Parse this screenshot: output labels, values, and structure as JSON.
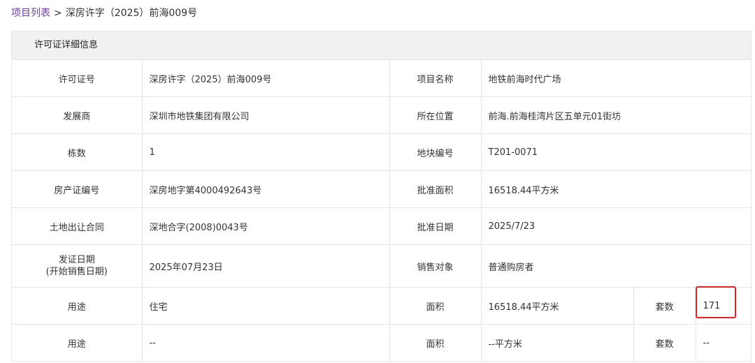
{
  "breadcrumb": {
    "root": "项目列表",
    "separator": ">",
    "current": "深房许字（2025）前海009号"
  },
  "panel": {
    "title": "许可证详细信息"
  },
  "rows": [
    {
      "l1": "许可证号",
      "v1": "深房许字（2025）前海009号",
      "l2": "项目名称",
      "v2": "地铁前海时代广场"
    },
    {
      "l1": "发展商",
      "v1": "深圳市地铁集团有限公司",
      "l2": "所在位置",
      "v2": "前海.前海桂湾片区五单元01街坊"
    },
    {
      "l1": "栋数",
      "v1": "1",
      "l2": "地块编号",
      "v2": "T201-0071"
    },
    {
      "l1": "房产证编号",
      "v1": "深房地字第4000492643号",
      "l2": "批准面积",
      "v2": "16518.44平方米"
    },
    {
      "l1": "土地出让合同",
      "v1": "深地合字(2008)0043号",
      "l2": "批准日期",
      "v2": "2025/7/23"
    },
    {
      "l1a": "发证日期",
      "l1b": "(开始销售日期)",
      "v1": "2025年07月23日",
      "l2": "销售对象",
      "v2": "普通购房者"
    }
  ],
  "usage_rows": [
    {
      "l1": "用途",
      "v1": "住宅",
      "l2": "面积",
      "v2": "16518.44平方米",
      "l3": "套数",
      "v3": "171"
    },
    {
      "l1": "用途",
      "v1": "--",
      "l2": "面积",
      "v2": "--平方米",
      "l3": "套数",
      "v3": "--"
    }
  ],
  "colors": {
    "link": "#6a3fa0",
    "border": "#e4e4e4",
    "header_bg": "#f1f1f1",
    "highlight": "#e02020"
  }
}
